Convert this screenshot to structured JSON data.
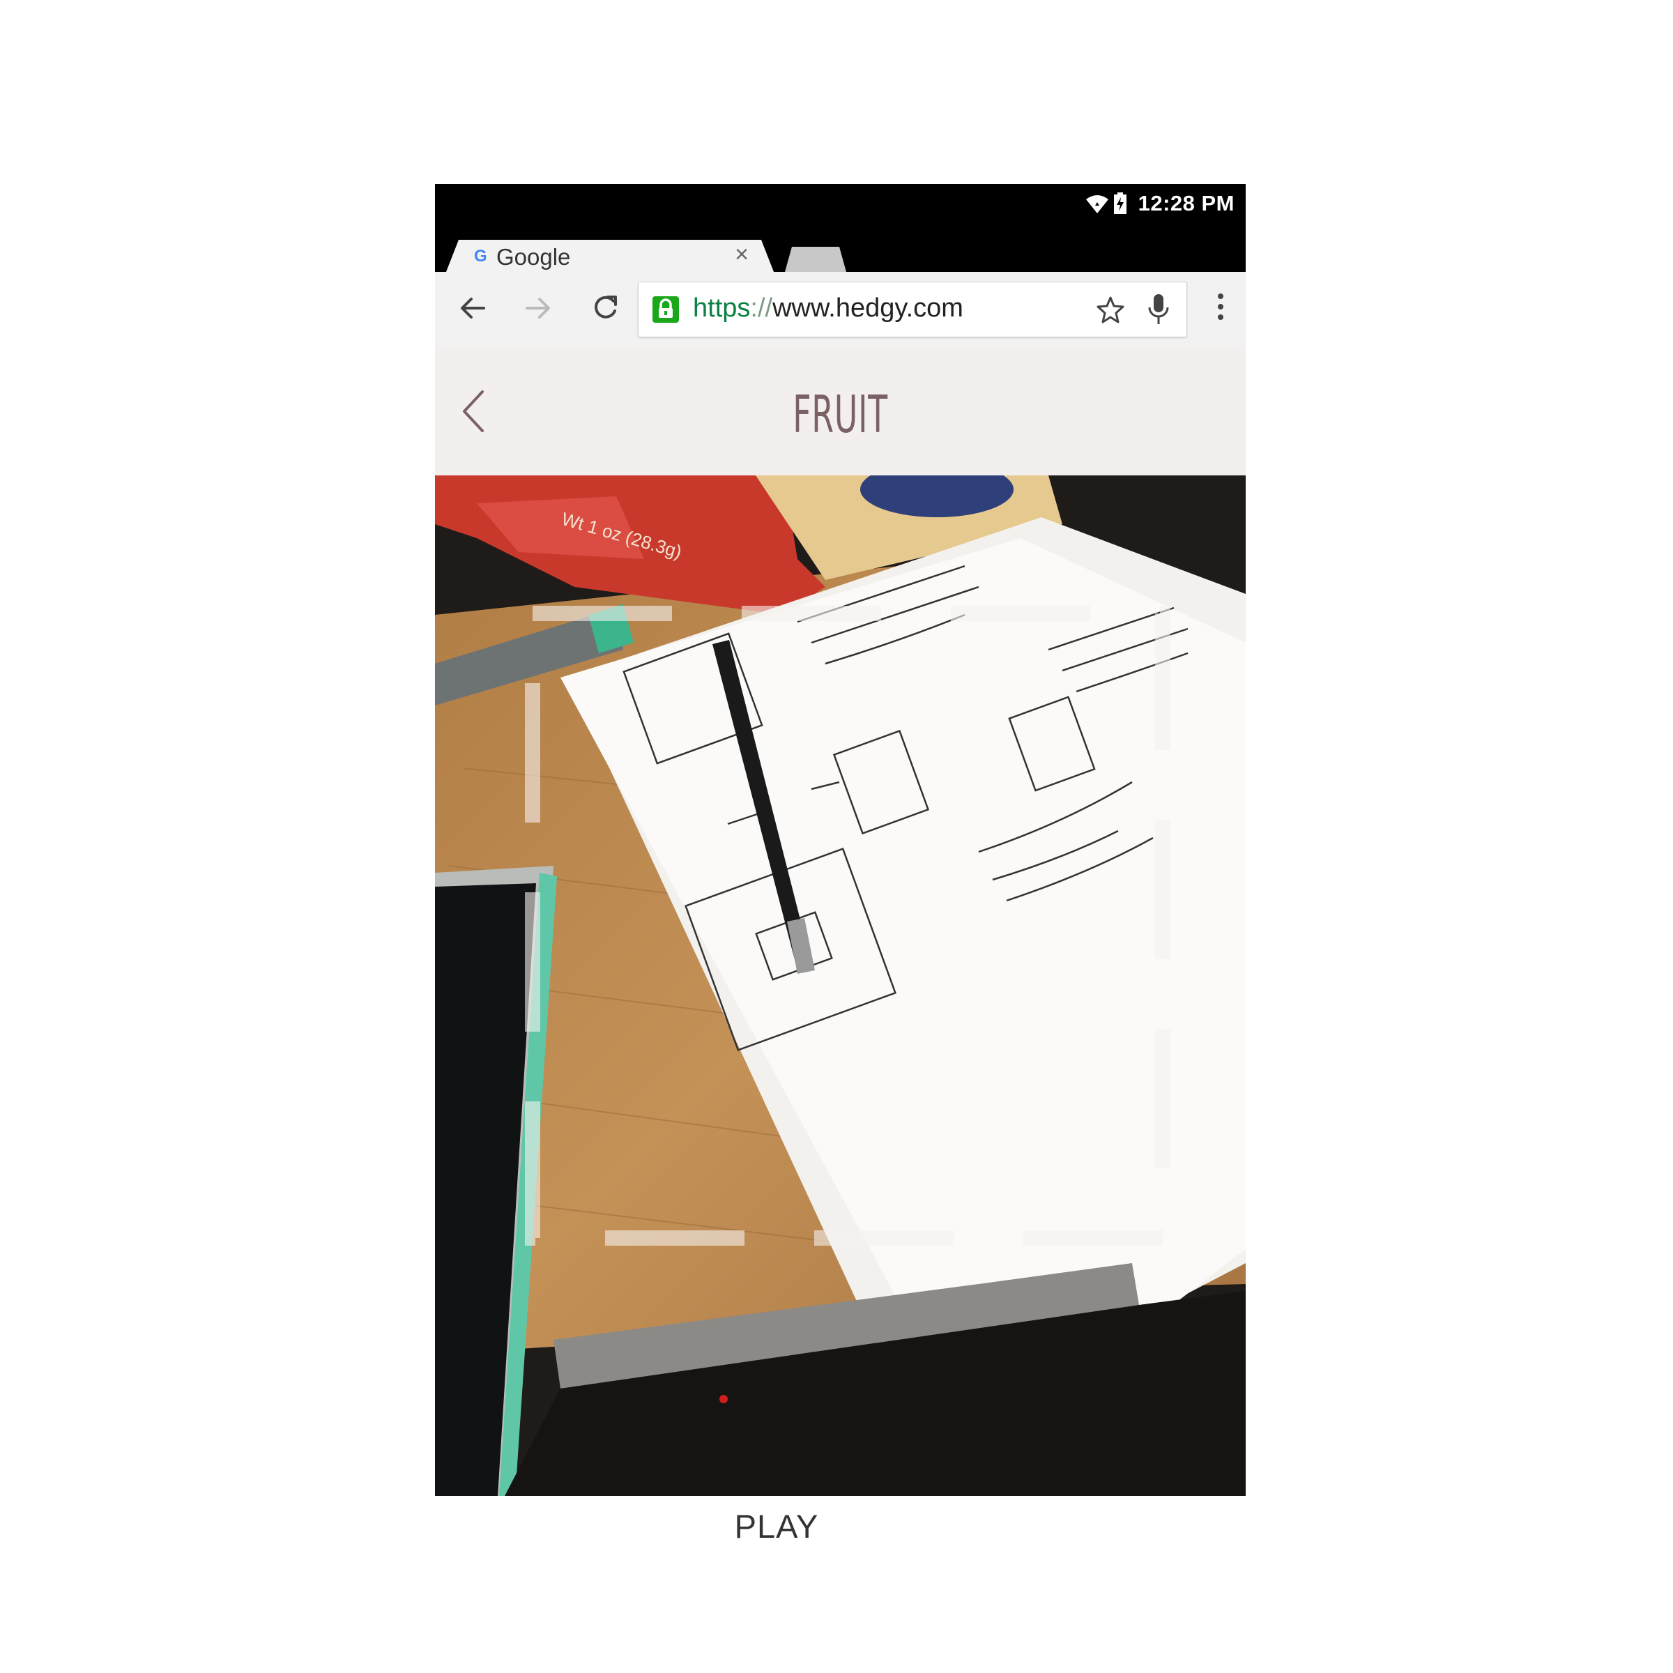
{
  "status_bar": {
    "time": "12:28 PM",
    "icons": [
      "wifi-icon",
      "battery-charging-icon"
    ]
  },
  "browser": {
    "tab": {
      "favicon": "G",
      "title": "Google",
      "close": "×"
    },
    "url": {
      "scheme": "https",
      "separator": "://",
      "host": "www.hedgy.com"
    },
    "toolbar_icons": [
      "back-arrow-icon",
      "forward-arrow-icon",
      "reload-icon",
      "lock-icon",
      "star-icon",
      "mic-icon",
      "menu-icon"
    ]
  },
  "app": {
    "header": {
      "title": "FRUIT",
      "back_icon": "chevron-left-icon"
    },
    "camera": {
      "viewfinder": "dashed-frame",
      "mic_button_icon": "microphone-icon"
    },
    "play_label": "PLAY"
  },
  "colors": {
    "header_bg": "#f3efef",
    "title": "#7a6264",
    "mic_button": "#dcc2c4",
    "url_scheme": "#0b8043",
    "lock": "#1aa81a"
  }
}
